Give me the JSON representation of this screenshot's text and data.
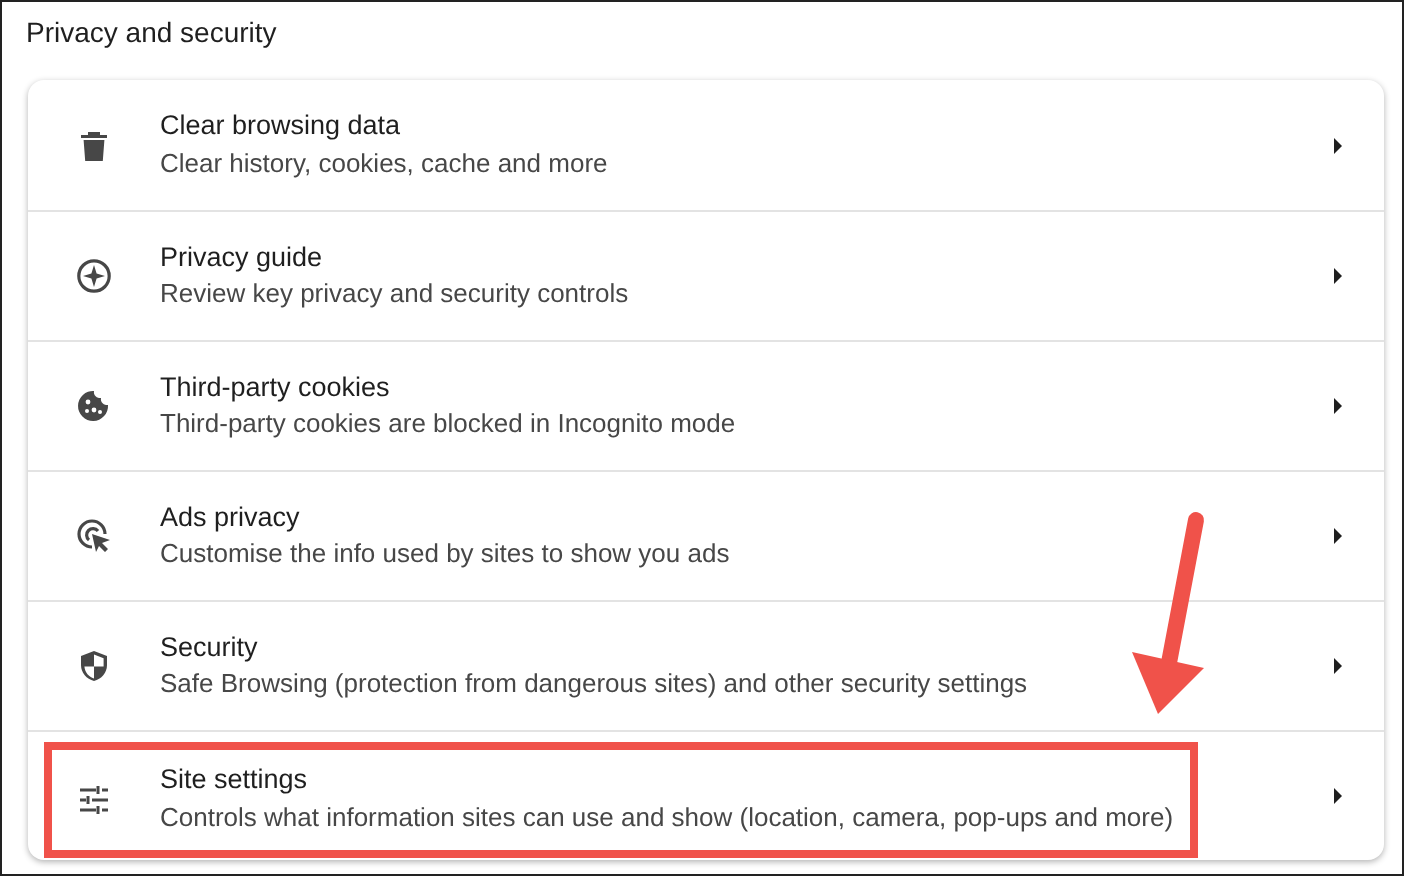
{
  "section_title": "Privacy and security",
  "items": [
    {
      "kind": "trash",
      "title": "Clear browsing data",
      "subtitle": "Clear history, cookies, cache and more",
      "highlighted": false
    },
    {
      "kind": "compass",
      "title": "Privacy guide",
      "subtitle": "Review key privacy and security controls",
      "highlighted": false
    },
    {
      "kind": "cookie",
      "title": "Third-party cookies",
      "subtitle": "Third-party cookies are blocked in Incognito mode",
      "highlighted": false
    },
    {
      "kind": "ads",
      "title": "Ads privacy",
      "subtitle": "Customise the info used by sites to show you ads",
      "highlighted": false
    },
    {
      "kind": "shield",
      "title": "Security",
      "subtitle": "Safe Browsing (protection from dangerous sites) and other security settings",
      "highlighted": false
    },
    {
      "kind": "sliders",
      "title": "Site settings",
      "subtitle": "Controls what information sites can use and show (location, camera, pop-ups and more)",
      "highlighted": true
    }
  ]
}
